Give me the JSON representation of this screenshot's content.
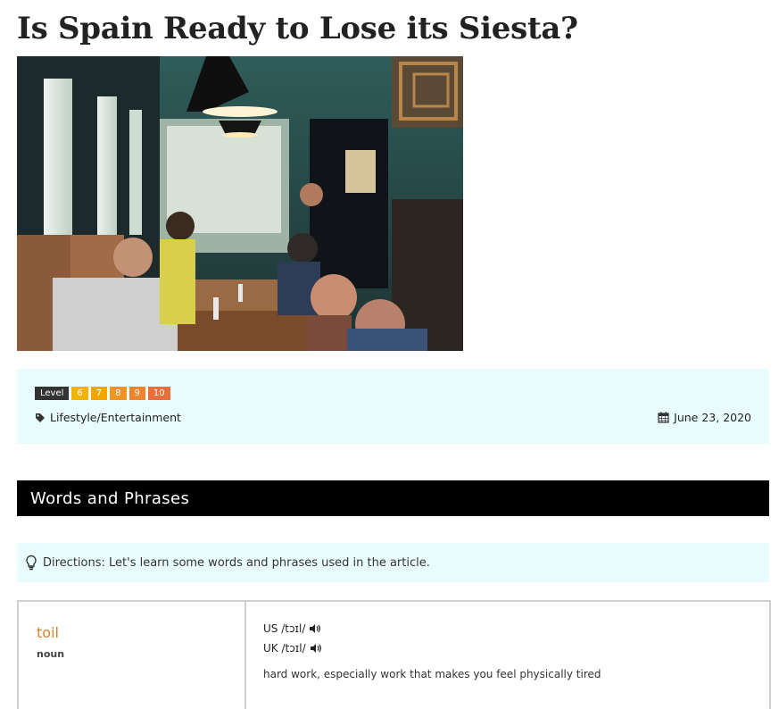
{
  "article": {
    "title": "Is Spain Ready to Lose its Siesta?"
  },
  "meta": {
    "level_label": "Level",
    "levels": [
      {
        "value": "6",
        "color": "#f4b300"
      },
      {
        "value": "7",
        "color": "#f4a600"
      },
      {
        "value": "8",
        "color": "#f39421"
      },
      {
        "value": "9",
        "color": "#ef842c"
      },
      {
        "value": "10",
        "color": "#e86f3c"
      }
    ],
    "category": "Lifestyle/Entertainment",
    "category_icon": "tag-icon",
    "date": "June 23, 2020",
    "date_icon": "calendar-icon"
  },
  "section": {
    "title": "Words and Phrases"
  },
  "directions": {
    "icon": "lightbulb-icon",
    "text": "Directions: Let's learn some words and phrases used in the article."
  },
  "vocab": {
    "word": "toil",
    "pos": "noun",
    "us": "US /tɔɪl/",
    "uk": "UK /tɔɪl/",
    "audio_icon": "speaker-icon",
    "definition": "hard work, especially work that makes you feel physically tired"
  }
}
